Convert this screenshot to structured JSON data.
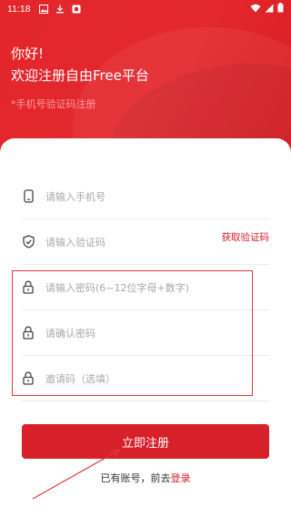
{
  "status_bar": {
    "time": "11:18",
    "icons_left": [
      "image-icon",
      "download-icon",
      "app-icon"
    ],
    "icons_right": [
      "wifi-icon",
      "signal-icon",
      "battery-icon"
    ]
  },
  "header": {
    "greeting": "你好!",
    "welcome": "欢迎注册自由Free平台",
    "subtitle": "*手机号验证码注册"
  },
  "form": {
    "phone_placeholder": "请输入手机号",
    "code_placeholder": "请输入验证码",
    "get_code_label": "获取验证码",
    "password_placeholder": "请输入密码(6~12位字母+数字)",
    "confirm_placeholder": "请确认密码",
    "invite_placeholder": "邀请码（选填）"
  },
  "actions": {
    "register_label": "立即注册",
    "have_account_text": "已有账号，前去",
    "login_link": "登录"
  },
  "colors": {
    "brand_red": "#d7202a",
    "header_red": "#e2262c",
    "annotation_red": "#e0383e"
  }
}
